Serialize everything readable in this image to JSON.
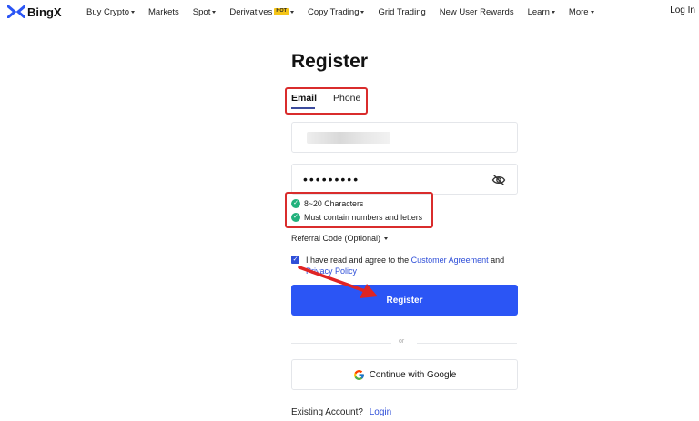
{
  "nav": {
    "brand": "BingX",
    "items": [
      {
        "label": "Buy Crypto",
        "has_caret": true
      },
      {
        "label": "Markets",
        "has_caret": false
      },
      {
        "label": "Spot",
        "has_caret": true
      },
      {
        "label": "Derivatives",
        "has_caret": true,
        "badge": "HOT"
      },
      {
        "label": "Copy Trading",
        "has_caret": true
      },
      {
        "label": "Grid Trading",
        "has_caret": false
      },
      {
        "label": "New User Rewards",
        "has_caret": false
      },
      {
        "label": "Learn",
        "has_caret": true
      },
      {
        "label": "More",
        "has_caret": true
      }
    ],
    "login": "Log In"
  },
  "form": {
    "title": "Register",
    "tabs": {
      "email": "Email",
      "phone": "Phone",
      "active": "Email"
    },
    "password_value": "•••••••••",
    "rules": [
      "8~20 Characters",
      "Must contain numbers and letters"
    ],
    "referral": "Referral Code (Optional)",
    "agree_prefix": "I have read and agree to the",
    "customer_agreement": "Customer Agreement",
    "agree_and": "and",
    "privacy_policy": "Privacy Policy",
    "agree_checked": true,
    "register_button": "Register",
    "or": "or",
    "google_button": "Continue with Google",
    "existing_account": "Existing Account?",
    "login_link": "Login"
  },
  "colors": {
    "accent": "#2b55f5",
    "link": "#2f4fd8",
    "success": "#21b17c",
    "highlight": "#d92c2c",
    "badge": "#f5c518"
  },
  "icons": {
    "logo": "bingx-logo-icon",
    "password_toggle": "eye-slash-icon",
    "rule": "check-circle-icon",
    "google": "google-icon",
    "annotation": "red-arrow-icon"
  }
}
